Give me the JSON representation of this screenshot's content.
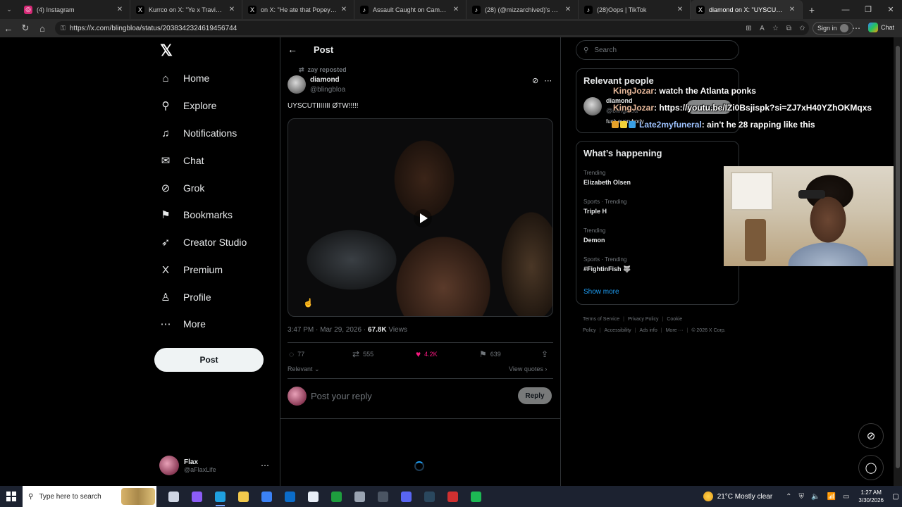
{
  "browser": {
    "tabs": [
      {
        "title": "(4) Instagram",
        "icon": "instagram-icon",
        "color": "#d62976",
        "active": false
      },
      {
        "title": "Kurrco on X: \"Ye x Travis Scott",
        "icon": "x-icon",
        "color": "#000000",
        "active": false
      },
      {
        "title": "on X: \"He ate that Popeyes biscu",
        "icon": "x-icon",
        "color": "#000000",
        "active": false
      },
      {
        "title": "Assault Caught on Camera: Two W",
        "icon": "tiktok-icon",
        "color": "#000000",
        "active": false
      },
      {
        "title": "(28) (@mizzarchived)'s video of B",
        "icon": "tiktok-icon",
        "color": "#000000",
        "active": false
      },
      {
        "title": "(28)Oops | TikTok",
        "icon": "tiktok-icon",
        "color": "#000000",
        "active": false
      },
      {
        "title": "diamond on X: \"UYSCUTIIIIII",
        "icon": "x-icon",
        "color": "#000000",
        "active": true
      }
    ],
    "url": "https://x.com/blingbloa/status/2038342324619456744",
    "sign_in": "Sign in",
    "chat": "Chat"
  },
  "nav": {
    "items": [
      {
        "label": "Home",
        "icon": "home-icon",
        "glyph": "⌂"
      },
      {
        "label": "Explore",
        "icon": "search-icon",
        "glyph": "⚲"
      },
      {
        "label": "Notifications",
        "icon": "bell-icon",
        "glyph": "♫"
      },
      {
        "label": "Chat",
        "icon": "mail-icon",
        "glyph": "✉"
      },
      {
        "label": "Grok",
        "icon": "grok-icon",
        "glyph": "⊘"
      },
      {
        "label": "Bookmarks",
        "icon": "bookmark-icon",
        "glyph": "⚑"
      },
      {
        "label": "Creator Studio",
        "icon": "rocket-icon",
        "glyph": "➶"
      },
      {
        "label": "Premium",
        "icon": "x-icon",
        "glyph": "X"
      },
      {
        "label": "Profile",
        "icon": "person-icon",
        "glyph": "♙"
      },
      {
        "label": "More",
        "icon": "more-circle-icon",
        "glyph": "⋯"
      }
    ],
    "post_button": "Post",
    "account": {
      "name": "Flax",
      "handle": "@aFlaxLife"
    }
  },
  "post": {
    "header_title": "Post",
    "reposted_by": "zay reposted",
    "author_name": "diamond",
    "author_handle": "@blingbloa",
    "text": "UYSCUTIIIIIII ØTW!!!!!",
    "timestamp": "3:47 PM · Mar 29, 2026 · ",
    "views_count": "67.8K",
    "views_label": " Views",
    "actions": {
      "replies": "77",
      "reposts": "555",
      "likes": "4.2K",
      "bookmarks": "639"
    },
    "sort_label": "Relevant",
    "view_quotes": "View quotes",
    "reply_placeholder": "Post your reply",
    "reply_button": "Reply"
  },
  "sidebar": {
    "search_placeholder": "Search",
    "relevant_people": {
      "title": "Relevant people",
      "name": "diamond",
      "handle": "@blingbloa",
      "bio": "fuck everybody",
      "follow": "Follow"
    },
    "whats_happening": {
      "title": "What’s happening",
      "trends": [
        {
          "label": "Trending",
          "name": "Elizabeth Olsen"
        },
        {
          "label": "Sports · Trending",
          "name": "Triple H"
        },
        {
          "label": "Trending",
          "name": "Demon"
        },
        {
          "label": "Sports · Trending",
          "name": "#FightinFish 🐺"
        }
      ],
      "show_more": "Show more"
    },
    "footer": [
      "Terms of Service",
      "Privacy Policy",
      "Cookie Policy",
      "Accessibility",
      "Ads info",
      "More ···",
      "© 2026 X Corp."
    ]
  },
  "stream_chat": [
    {
      "user": "KingJozar",
      "message": "watch the Atlanta ponks"
    },
    {
      "user": "KingJozar",
      "message": "https://youtu.be/IZi0Bsjispk?si=ZJ7xH40YZhOKMqxs"
    },
    {
      "user": "Late2myfuneral",
      "message": "ain't he 28 rapping like this"
    }
  ],
  "taskbar": {
    "search_placeholder": "Type here to search",
    "weather": "21°C  Mostly clear",
    "time": "1:27 AM",
    "date": "3/30/2026",
    "apps": [
      {
        "icon": "task-view-icon",
        "color": "#cfd6e4"
      },
      {
        "icon": "copilot-icon",
        "color": "#8b5cf6"
      },
      {
        "icon": "edge-icon",
        "color": "#1fa0e0",
        "active": true
      },
      {
        "icon": "file-explorer-icon",
        "color": "#f2c94c"
      },
      {
        "icon": "store-icon",
        "color": "#3b82f6"
      },
      {
        "icon": "outlook-icon",
        "color": "#0b6cc9"
      },
      {
        "icon": "notepad-icon",
        "color": "#e8eef7"
      },
      {
        "icon": "xbox-icon",
        "color": "#1e9e3e"
      },
      {
        "icon": "app-icon",
        "color": "#9aa4b2"
      },
      {
        "icon": "obs-icon",
        "color": "#4b5563"
      },
      {
        "icon": "discord-icon",
        "color": "#5865f2"
      },
      {
        "icon": "steam-icon",
        "color": "#2a475e"
      },
      {
        "icon": "record-icon",
        "color": "#d03030"
      },
      {
        "icon": "spotify-icon",
        "color": "#1db954"
      }
    ]
  }
}
